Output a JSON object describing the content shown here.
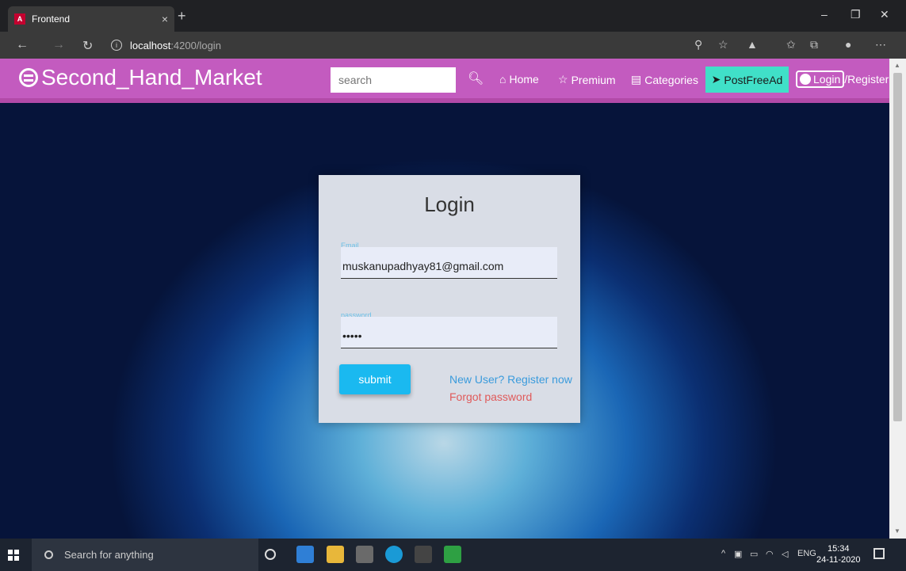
{
  "browser": {
    "tab_title": "Frontend",
    "tab_favicon": "A",
    "tab_close": "×",
    "new_tab": "+",
    "url_host": "localhost",
    "url_path": ":4200/login",
    "win_minimize": "–",
    "win_restore": "❐",
    "win_close": "✕"
  },
  "navbar": {
    "brand": "Second_Hand_Market",
    "search_placeholder": "search",
    "links": [
      {
        "label": "Home",
        "icon": "home-icon"
      },
      {
        "label": "Premium",
        "icon": "star-icon"
      },
      {
        "label": "Categories",
        "icon": "document-icon"
      }
    ],
    "post_ad": "PostFreeAd",
    "login": "Login",
    "register": "/Register"
  },
  "login": {
    "title": "Login",
    "email_label": "Email",
    "email_value": "muskanupadhyay81@gmail.com",
    "password_label": "password",
    "password_value": "•••••",
    "submit": "submit",
    "register_link": "New User? Register now",
    "forgot_link": "Forgot password"
  },
  "taskbar": {
    "search_placeholder": "Search for anything",
    "tray_lang": "ENG",
    "time": "15:34",
    "date": "24-11-2020"
  },
  "colors": {
    "navbar": "#c35bbf",
    "post_ad": "#40e0c8",
    "submit": "#1ab9f0",
    "register_link": "#3a9bdc",
    "forgot_link": "#e05a5a"
  }
}
